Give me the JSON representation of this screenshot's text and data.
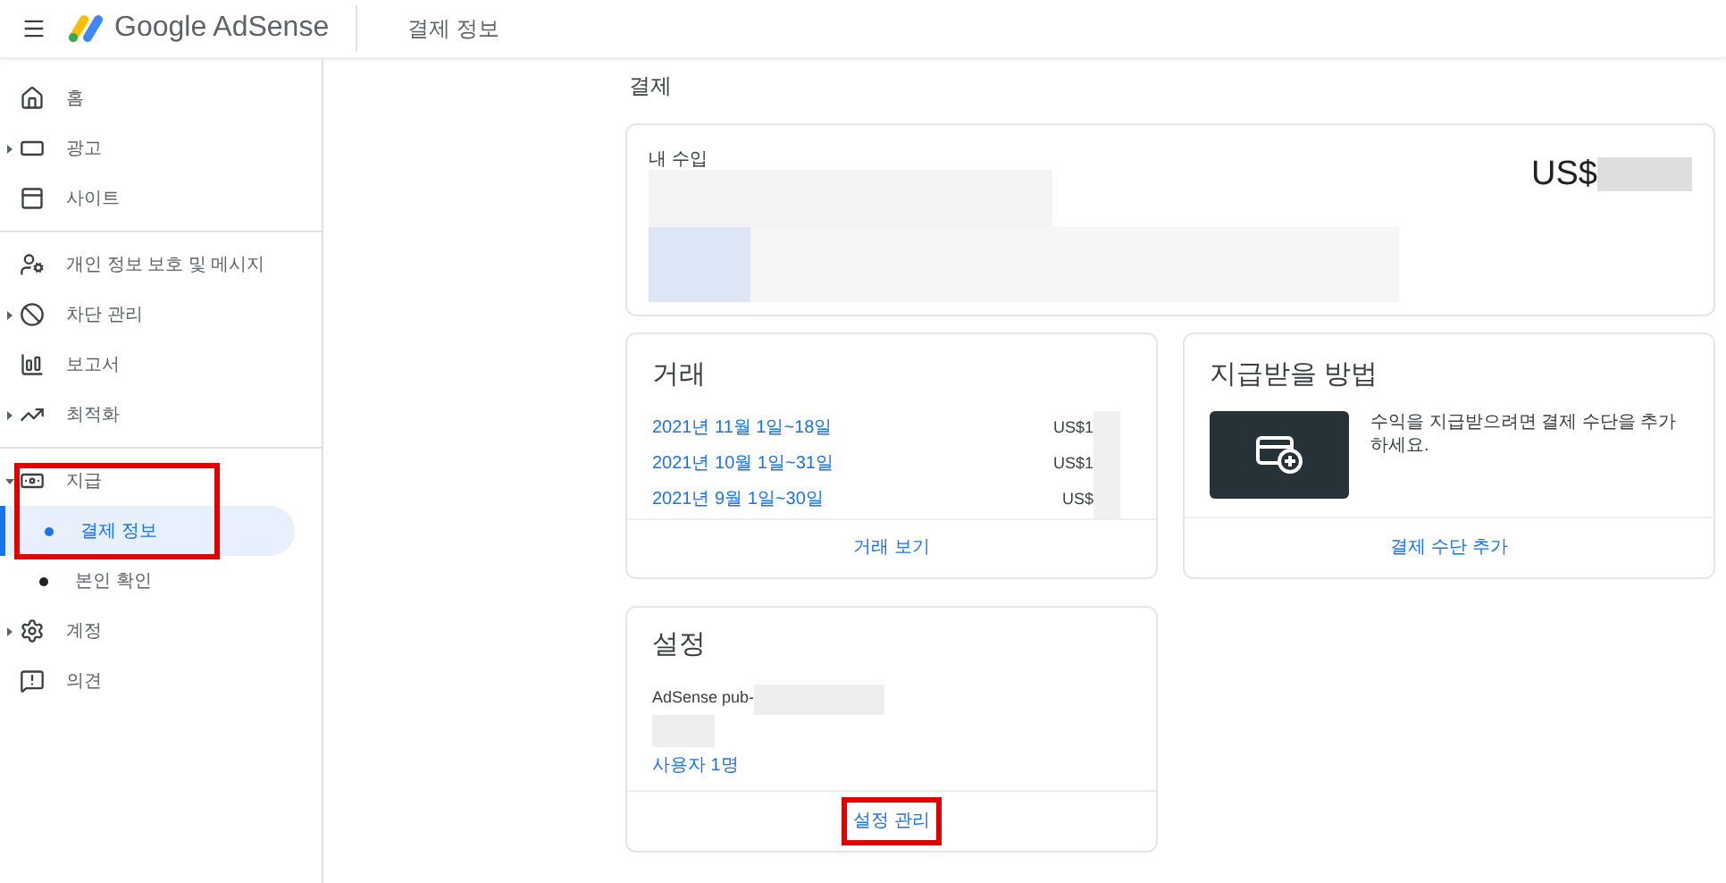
{
  "header": {
    "brand": "Google AdSense",
    "page_title": "결제 정보"
  },
  "sidebar": {
    "sections": [
      {
        "items": [
          {
            "label": "홈",
            "kind": "link"
          },
          {
            "label": "광고",
            "kind": "group",
            "expanded": false
          },
          {
            "label": "사이트",
            "kind": "link"
          }
        ]
      },
      {
        "items": [
          {
            "label": "개인 정보 보호 및 메시지",
            "kind": "link"
          },
          {
            "label": "차단 관리",
            "kind": "group",
            "expanded": false
          },
          {
            "label": "보고서",
            "kind": "link"
          },
          {
            "label": "최적화",
            "kind": "group",
            "expanded": false
          }
        ]
      },
      {
        "items": [
          {
            "label": "지급",
            "kind": "group",
            "expanded": true,
            "highlighted": true,
            "children": [
              {
                "label": "결제 정보",
                "selected": true
              },
              {
                "label": "본인 확인",
                "selected": false
              }
            ]
          },
          {
            "label": "계정",
            "kind": "group",
            "expanded": false
          },
          {
            "label": "의견",
            "kind": "link"
          }
        ]
      }
    ]
  },
  "main": {
    "title": "결제",
    "earnings": {
      "label": "내 수입",
      "amount": "US$"
    },
    "transactions": {
      "title": "거래",
      "rows": [
        {
          "period": "2021년 11월 1일~18일",
          "amount": "US$1"
        },
        {
          "period": "2021년 10월 1일~31일",
          "amount": "US$1"
        },
        {
          "period": "2021년 9월 1일~30일",
          "amount": "US$"
        }
      ],
      "action": "거래 보기"
    },
    "payment_method": {
      "title": "지급받을 방법",
      "description": "수익을 지급받으려면 결제 수단을 추가하세요.",
      "action": "결제 수단 추가"
    },
    "settings": {
      "title": "설정",
      "account": "AdSense pub-",
      "users": "사용자 1명",
      "action": "설정 관리",
      "action_highlighted": true
    }
  }
}
